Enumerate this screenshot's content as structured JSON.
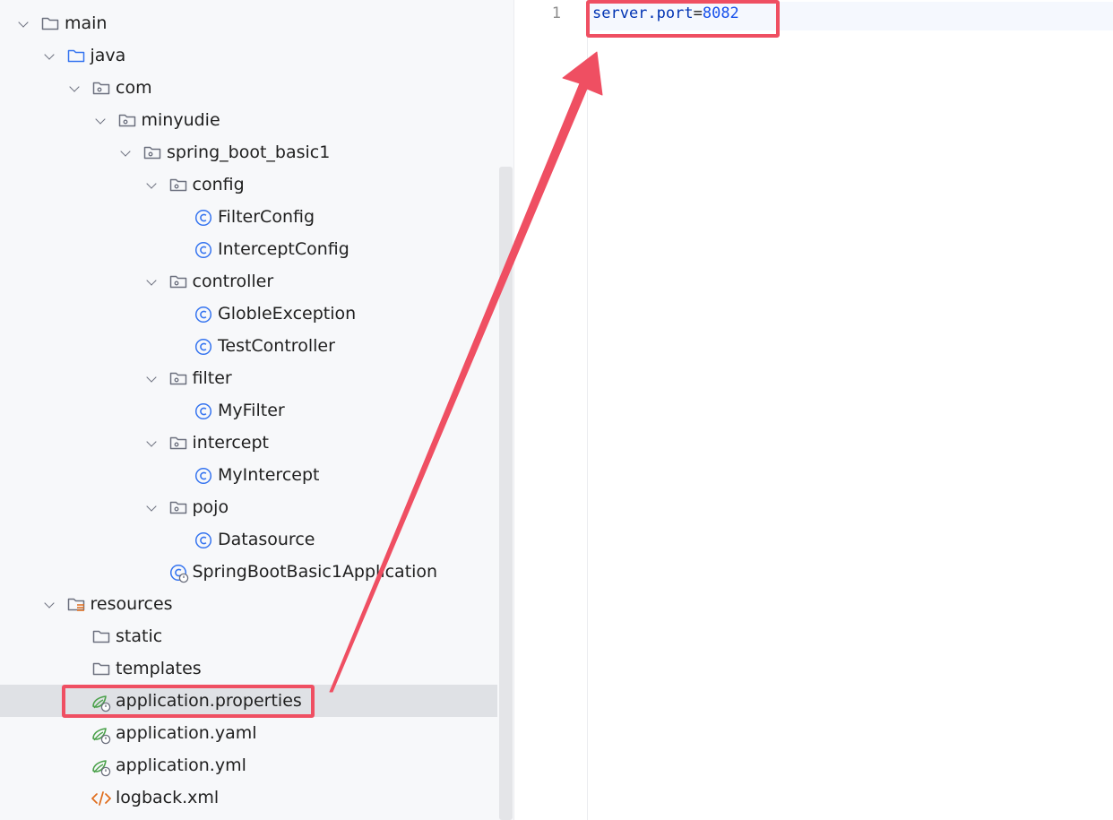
{
  "project_tree": {
    "items": [
      {
        "label": "main",
        "icon": "folder-icon",
        "expanded": true
      },
      {
        "label": "java",
        "icon": "source-folder-icon",
        "expanded": true
      },
      {
        "label": "com",
        "icon": "package-icon",
        "expanded": true
      },
      {
        "label": "minyudie",
        "icon": "package-icon",
        "expanded": true
      },
      {
        "label": "spring_boot_basic1",
        "icon": "package-icon",
        "expanded": true
      },
      {
        "label": "config",
        "icon": "package-icon",
        "expanded": true
      },
      {
        "label": "FilterConfig",
        "icon": "java-class-icon"
      },
      {
        "label": "InterceptConfig",
        "icon": "java-class-icon"
      },
      {
        "label": "controller",
        "icon": "package-icon",
        "expanded": true
      },
      {
        "label": "GlobleException",
        "icon": "java-class-icon"
      },
      {
        "label": "TestController",
        "icon": "java-class-icon"
      },
      {
        "label": "filter",
        "icon": "package-icon",
        "expanded": true
      },
      {
        "label": "MyFilter",
        "icon": "java-class-icon"
      },
      {
        "label": "intercept",
        "icon": "package-icon",
        "expanded": true
      },
      {
        "label": "MyIntercept",
        "icon": "java-class-icon"
      },
      {
        "label": "pojo",
        "icon": "package-icon",
        "expanded": true
      },
      {
        "label": "Datasource",
        "icon": "java-class-icon"
      },
      {
        "label": "SpringBootBasic1Application",
        "icon": "spring-boot-class-icon"
      },
      {
        "label": "resources",
        "icon": "resources-folder-icon",
        "expanded": true
      },
      {
        "label": "static",
        "icon": "folder-icon"
      },
      {
        "label": "templates",
        "icon": "folder-icon"
      },
      {
        "label": "application.properties",
        "icon": "spring-config-icon",
        "selected": true
      },
      {
        "label": "application.yaml",
        "icon": "spring-config-icon"
      },
      {
        "label": "application.yml",
        "icon": "spring-config-icon"
      },
      {
        "label": "logback.xml",
        "icon": "xml-file-icon"
      }
    ]
  },
  "editor": {
    "line_number": "1",
    "code": {
      "key": "server.port",
      "operator": "=",
      "value": "8082"
    }
  },
  "colors": {
    "annotation": "#ef4f62",
    "keyword_blue": "#0033b3",
    "number_blue": "#1750eb",
    "class_icon_blue": "#3574f0",
    "spring_green": "#4aa14a",
    "xml_orange": "#e06c1a",
    "selection": "#dfe1e5"
  }
}
